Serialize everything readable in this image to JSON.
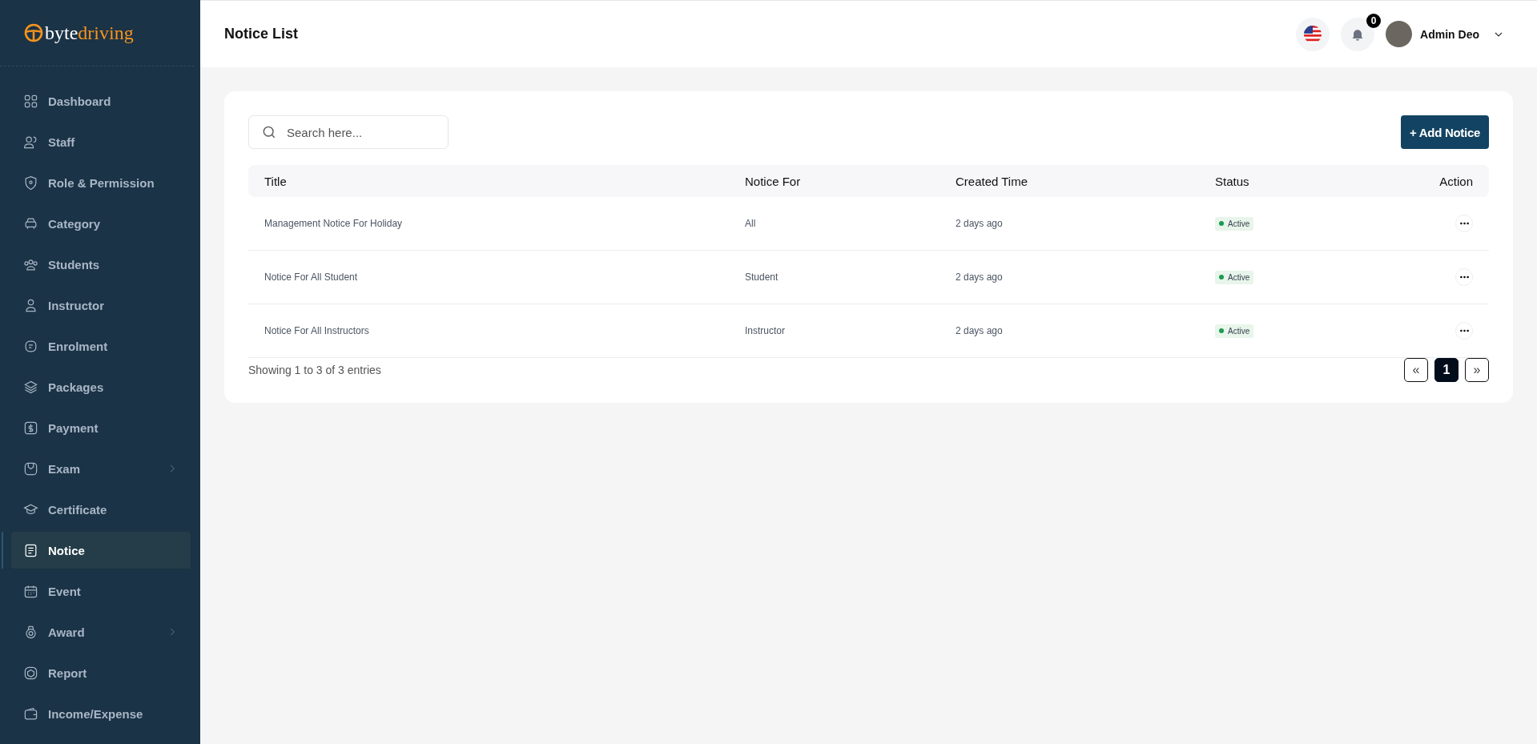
{
  "brand": {
    "prefix": "byte",
    "suffix": "driving"
  },
  "sidebar": {
    "items": [
      {
        "label": "Dashboard",
        "selected": false,
        "has_submenu": false
      },
      {
        "label": "Staff",
        "selected": false,
        "has_submenu": false
      },
      {
        "label": "Role & Permission",
        "selected": false,
        "has_submenu": false
      },
      {
        "label": "Category",
        "selected": false,
        "has_submenu": false
      },
      {
        "label": "Students",
        "selected": false,
        "has_submenu": false
      },
      {
        "label": "Instructor",
        "selected": false,
        "has_submenu": false
      },
      {
        "label": "Enrolment",
        "selected": false,
        "has_submenu": false
      },
      {
        "label": "Packages",
        "selected": false,
        "has_submenu": false
      },
      {
        "label": "Payment",
        "selected": false,
        "has_submenu": false
      },
      {
        "label": "Exam",
        "selected": false,
        "has_submenu": true
      },
      {
        "label": "Certificate",
        "selected": false,
        "has_submenu": false
      },
      {
        "label": "Notice",
        "selected": true,
        "has_submenu": false
      },
      {
        "label": "Event",
        "selected": false,
        "has_submenu": false
      },
      {
        "label": "Award",
        "selected": false,
        "has_submenu": true
      },
      {
        "label": "Report",
        "selected": false,
        "has_submenu": false
      },
      {
        "label": "Income/Expense",
        "selected": false,
        "has_submenu": false
      }
    ]
  },
  "header": {
    "title": "Notice List",
    "notification_count": "0",
    "user_name": "Admin Deo"
  },
  "toolbar": {
    "search": {
      "placeholder": "Search here..."
    },
    "add_button": "+ Add Notice"
  },
  "table": {
    "columns": [
      "Title",
      "Notice For",
      "Created Time",
      "Status",
      "Action"
    ],
    "rows": [
      {
        "title": "Management Notice For Holiday",
        "notice_for": "All",
        "created_time": "2 days ago",
        "status": "Active"
      },
      {
        "title": "Notice For All Student",
        "notice_for": "Student",
        "created_time": "2 days ago",
        "status": "Active"
      },
      {
        "title": "Notice For All Instructors",
        "notice_for": "Instructor",
        "created_time": "2 days ago",
        "status": "Active"
      }
    ]
  },
  "footer": {
    "summary": "Showing 1 to 3 of 3 entries",
    "prev": "«",
    "pages": [
      {
        "label": "1",
        "selected": true
      }
    ],
    "next": "»"
  }
}
